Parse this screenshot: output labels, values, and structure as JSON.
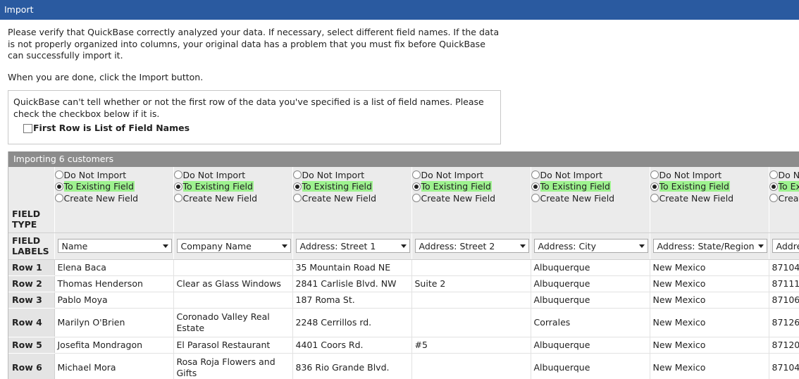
{
  "window": {
    "title": "Import"
  },
  "intro": {
    "text": "Please verify that QuickBase correctly analyzed your data. If necessary, select different field names. If the data is not properly organized into columns, your original data has a problem that you must fix before QuickBase can successfully import it.",
    "done_text": "When you are done, click the Import button."
  },
  "notice": {
    "text": "QuickBase can't tell whether or not the first row of the data you've specified is a list of field names. Please check the checkbox below if it is.",
    "checkbox_label": "First Row is List of Field Names",
    "checked": false
  },
  "grid": {
    "header": "Importing 6 customers",
    "options": [
      "Do Not Import",
      "To Existing Field",
      "Create New Field"
    ],
    "selected_option": "To Existing Field",
    "field_type_label": "FIELD TYPE",
    "field_labels_label": "FIELD LABELS",
    "columns": [
      {
        "field": "Name"
      },
      {
        "field": "Company Name"
      },
      {
        "field": "Address: Street 1"
      },
      {
        "field": "Address: Street 2"
      },
      {
        "field": "Address: City"
      },
      {
        "field": "Address: State/Region"
      },
      {
        "field": "Address: Postal Code"
      }
    ],
    "rows": [
      {
        "label": "Row 1",
        "cells": [
          "Elena Baca",
          "",
          "35 Mountain Road NE",
          "",
          "Albuquerque",
          "New Mexico",
          "87104"
        ]
      },
      {
        "label": "Row 2",
        "cells": [
          "Thomas Henderson",
          "Clear as Glass Windows",
          "2841 Carlisle Blvd. NW",
          "Suite 2",
          "Albuquerque",
          "New Mexico",
          "87111"
        ]
      },
      {
        "label": "Row 3",
        "cells": [
          "Pablo Moya",
          "",
          "187 Roma St.",
          "",
          "Albuquerque",
          "New Mexico",
          "87106"
        ]
      },
      {
        "label": "Row 4",
        "cells": [
          "Marilyn O'Brien",
          "Coronado Valley Real Estate",
          "2248 Cerrillos rd.",
          "",
          "Corrales",
          "New Mexico",
          "87126"
        ]
      },
      {
        "label": "Row 5",
        "cells": [
          "Josefita Mondragon",
          "El Parasol Restaurant",
          "4401 Coors Rd.",
          "#5",
          "Albuquerque",
          "New Mexico",
          "87120"
        ]
      },
      {
        "label": "Row 6",
        "cells": [
          "Michael Mora",
          "Rosa Roja Flowers and Gifts",
          "836 Rio Grande Blvd.",
          "",
          "Albuquerque",
          "New Mexico",
          "87104"
        ]
      }
    ]
  },
  "colors": {
    "titlebar": "#2a5aa0",
    "highlight": "#9ef28f",
    "grid_header": "#8c8c8c"
  }
}
